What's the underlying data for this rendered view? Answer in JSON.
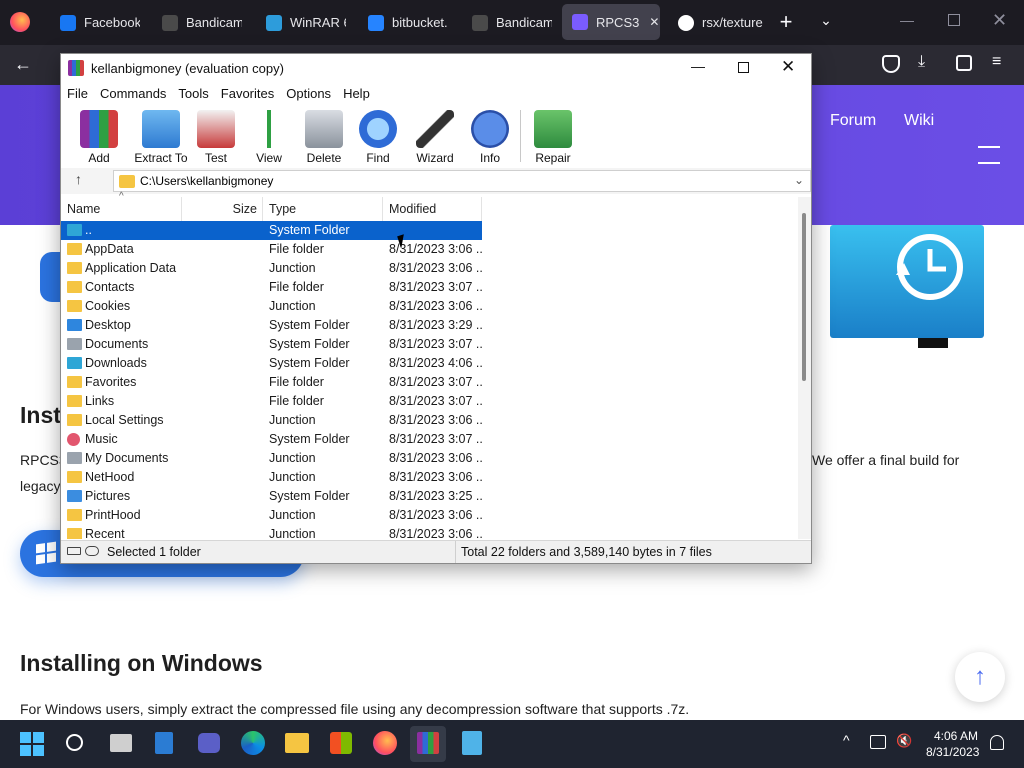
{
  "browser": {
    "tabs": [
      {
        "label": "Facebook",
        "icon": "facebook-icon",
        "color": "#1877f2"
      },
      {
        "label": "Bandicam",
        "icon": "bandicam-icon",
        "color": "#4a4a4a"
      },
      {
        "label": "WinRAR 6...",
        "icon": "winrar-icon",
        "color": "#2d9cdb"
      },
      {
        "label": "bitbucket.o",
        "icon": "bitbucket-icon",
        "color": "#2684ff"
      },
      {
        "label": "Bandicam",
        "icon": "bandicam-icon",
        "color": "#4a4a4a"
      },
      {
        "label": "RPCS3",
        "icon": "rpcs3-icon",
        "color": "#7a5cff",
        "active": true
      },
      {
        "label": "rsx/texture",
        "icon": "github-icon",
        "color": "#ffffff"
      }
    ]
  },
  "webpage": {
    "nav": {
      "forum": "Forum",
      "wiki": "Wiki"
    },
    "heading_partial": "Inst",
    "para_partial": "RPCS3",
    "para_partial_2": "legacy",
    "para_right": "We offer a final build for",
    "heading": "Installing on Windows",
    "paragraph": "For Windows users, simply extract the compressed file using any decompression software that supports .7z."
  },
  "winrar": {
    "title": "kellanbigmoney (evaluation copy)",
    "menu": [
      "File",
      "Commands",
      "Tools",
      "Favorites",
      "Options",
      "Help"
    ],
    "toolbar": [
      {
        "label": "Add",
        "icon": "add-archive-icon"
      },
      {
        "label": "Extract To",
        "icon": "extract-to-icon"
      },
      {
        "label": "Test",
        "icon": "test-icon"
      },
      {
        "label": "View",
        "icon": "view-book-icon"
      },
      {
        "label": "Delete",
        "icon": "delete-bin-icon"
      },
      {
        "label": "Find",
        "icon": "find-magnifier-icon"
      },
      {
        "label": "Wizard",
        "icon": "wizard-wand-icon"
      },
      {
        "label": "Info",
        "icon": "info-icon"
      },
      {
        "label": "Repair",
        "icon": "repair-icon"
      }
    ],
    "path": "C:\\Users\\kellanbigmoney",
    "columns": [
      "Name",
      "Size",
      "Type",
      "Modified"
    ],
    "rows": [
      {
        "name": "..",
        "type": "System Folder",
        "modified": "",
        "icon": "parent-folder-icon",
        "selected": true
      },
      {
        "name": "AppData",
        "type": "File folder",
        "modified": "8/31/2023 3:06 ...",
        "icon": "folder-icon"
      },
      {
        "name": "Application Data",
        "type": "Junction",
        "modified": "8/31/2023 3:06 ...",
        "icon": "folder-icon"
      },
      {
        "name": "Contacts",
        "type": "File folder",
        "modified": "8/31/2023 3:07 ...",
        "icon": "folder-icon"
      },
      {
        "name": "Cookies",
        "type": "Junction",
        "modified": "8/31/2023 3:06 ...",
        "icon": "folder-icon"
      },
      {
        "name": "Desktop",
        "type": "System Folder",
        "modified": "8/31/2023 3:29 ...",
        "icon": "desktop-icon"
      },
      {
        "name": "Documents",
        "type": "System Folder",
        "modified": "8/31/2023 3:07 ...",
        "icon": "documents-icon"
      },
      {
        "name": "Downloads",
        "type": "System Folder",
        "modified": "8/31/2023 4:06 ...",
        "icon": "downloads-icon"
      },
      {
        "name": "Favorites",
        "type": "File folder",
        "modified": "8/31/2023 3:07 ...",
        "icon": "folder-icon"
      },
      {
        "name": "Links",
        "type": "File folder",
        "modified": "8/31/2023 3:07 ...",
        "icon": "folder-icon"
      },
      {
        "name": "Local Settings",
        "type": "Junction",
        "modified": "8/31/2023 3:06 ...",
        "icon": "folder-icon"
      },
      {
        "name": "Music",
        "type": "System Folder",
        "modified": "8/31/2023 3:07 ...",
        "icon": "music-icon"
      },
      {
        "name": "My Documents",
        "type": "Junction",
        "modified": "8/31/2023 3:06 ...",
        "icon": "documents-icon"
      },
      {
        "name": "NetHood",
        "type": "Junction",
        "modified": "8/31/2023 3:06 ...",
        "icon": "folder-icon"
      },
      {
        "name": "Pictures",
        "type": "System Folder",
        "modified": "8/31/2023 3:25 ...",
        "icon": "pictures-icon"
      },
      {
        "name": "PrintHood",
        "type": "Junction",
        "modified": "8/31/2023 3:06 ...",
        "icon": "folder-icon"
      },
      {
        "name": "Recent",
        "type": "Junction",
        "modified": "8/31/2023 3:06 ...",
        "icon": "folder-icon"
      }
    ],
    "status_left": "Selected 1 folder",
    "status_right": "Total 22 folders and 3,589,140 bytes in 7 files"
  },
  "taskbar": {
    "time": "4:06 AM",
    "date": "8/31/2023"
  },
  "colors": {
    "selection": "#0a62cc",
    "accent": "#5b3fd6",
    "folder": "#f5c542"
  }
}
